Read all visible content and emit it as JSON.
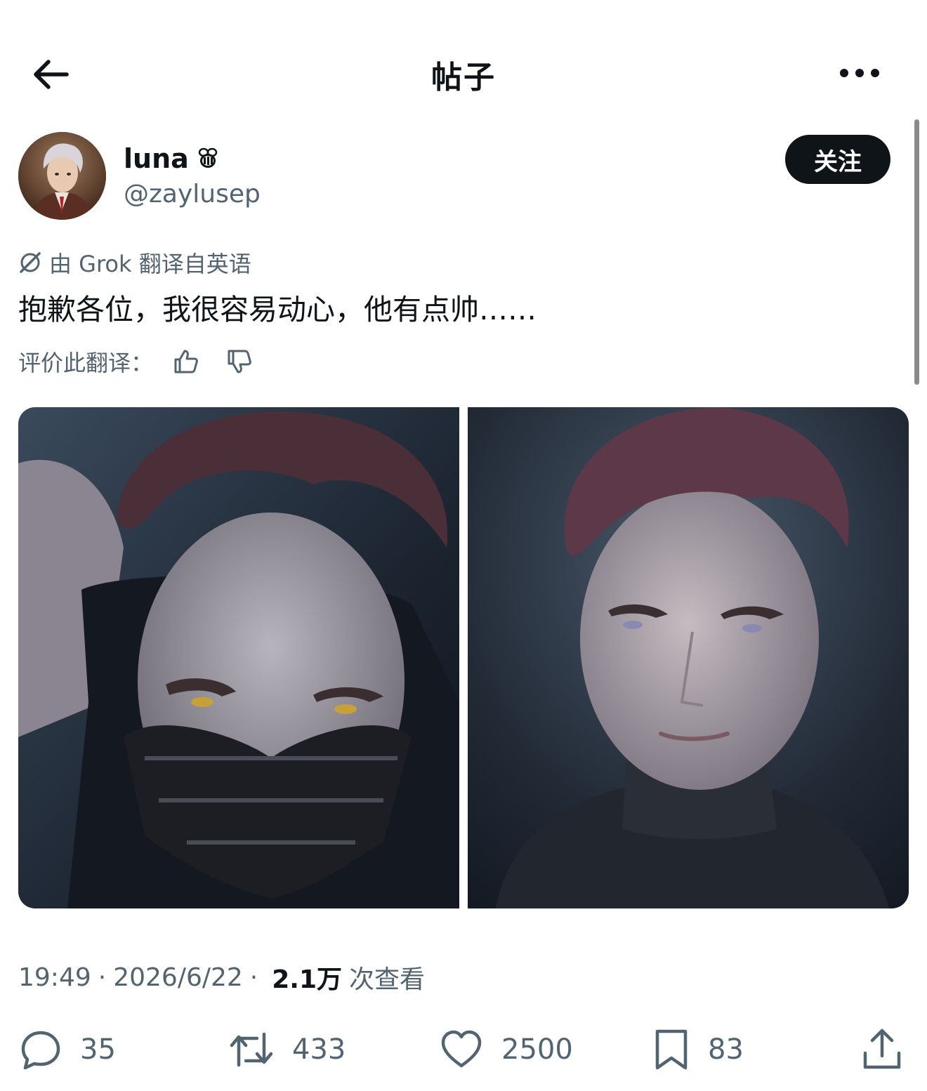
{
  "header": {
    "back_icon": "arrow-left-icon",
    "title": "帖子",
    "more_icon": "more-horizontal-icon"
  },
  "author": {
    "avatar_icon": "user-avatar",
    "name": "luna",
    "name_badge_icon": "bee-emoji-icon",
    "handle": "@zaylusep",
    "follow_label": "关注"
  },
  "post": {
    "translation_note": "由 Grok 翻译自英语",
    "translation_icon": "grok-icon",
    "text": "抱歉各位，我很容易动心，他有点帅……",
    "rate_label": "评价此翻译：",
    "media": [
      {
        "alt_icon": "photo-masked-character"
      },
      {
        "alt_icon": "photo-character-portrait"
      }
    ],
    "time": "19:49",
    "separator": "·",
    "date": "2026/6/22",
    "views_count": "2.1万",
    "views_label": "次查看"
  },
  "actions": {
    "replies": "35",
    "reposts": "433",
    "likes": "2500",
    "bookmarks": "83"
  },
  "colors": {
    "text_primary": "#0f1419",
    "text_secondary": "#536471",
    "follow_bg": "#0f1419"
  }
}
